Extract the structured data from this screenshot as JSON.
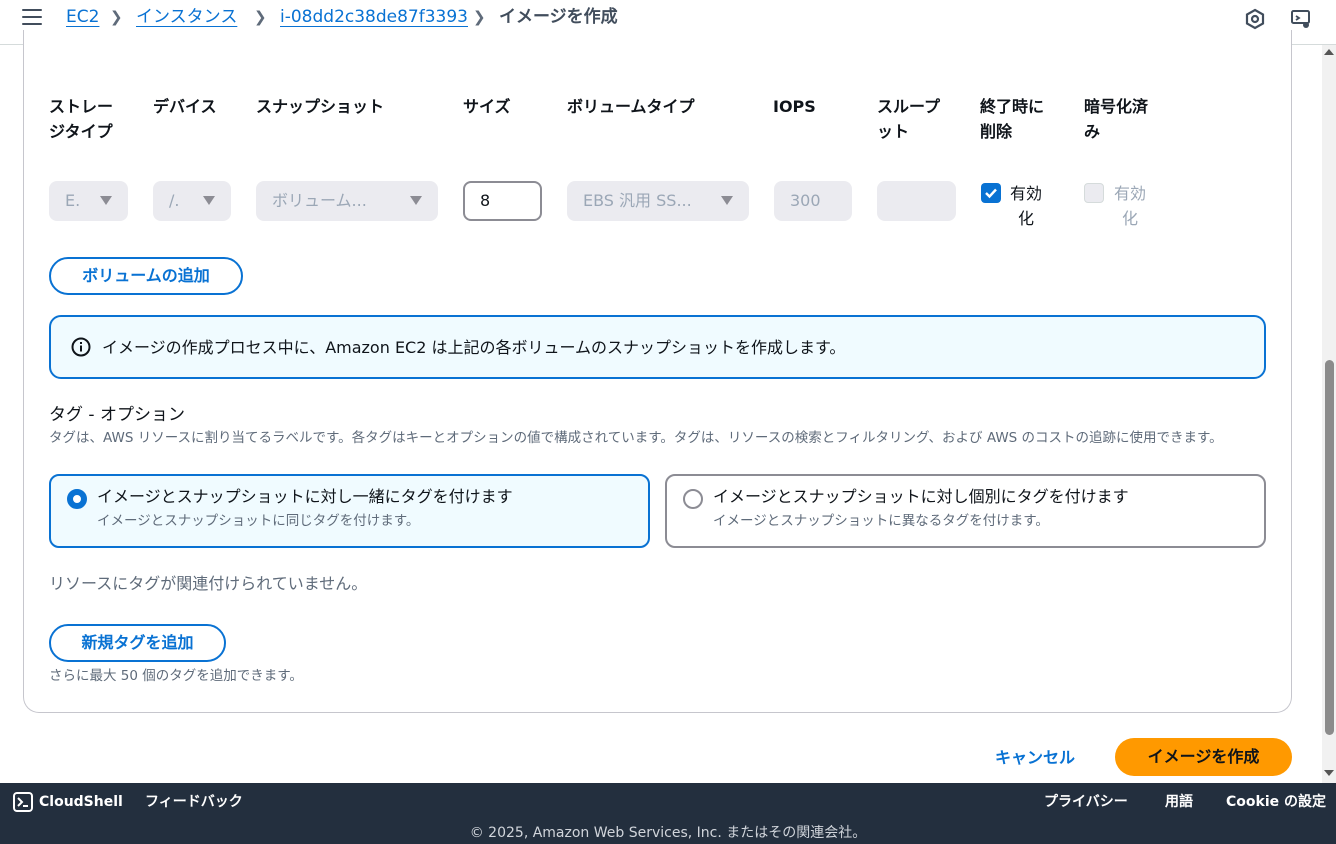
{
  "breadcrumb": {
    "items": [
      "EC2",
      "インスタンス",
      "i-08dd2c38de87f3393"
    ],
    "current": "イメージを作成"
  },
  "volume_table": {
    "headers": {
      "storage_type": "ストレージタイプ",
      "storage_type_line1": "ストレー",
      "storage_type_line2": "ジタイプ",
      "device": "デバイス",
      "snapshot": "スナップショット",
      "size": "サイズ",
      "volume_type": "ボリュームタイプ",
      "iops": "IOPS",
      "throughput_line1": "スループ",
      "throughput_line2": "ット",
      "delete_line1": "終了時に",
      "delete_line2": "削除",
      "encrypted_line1": "暗号化済",
      "encrypted_line2": "み"
    },
    "row": {
      "storage_type": "E.",
      "device": "/.",
      "snapshot": "ボリューム...",
      "size": "8",
      "volume_type": "EBS 汎用 SS...",
      "iops": "300",
      "throughput": "",
      "delete_on_termination_line1": "有効",
      "delete_on_termination_line2": "化",
      "encrypted_line1": "有効",
      "encrypted_line2": "化"
    }
  },
  "add_volume_label": "ボリュームの追加",
  "info_text": "イメージの作成プロセス中に、Amazon EC2 は上記の各ボリュームのスナップショットを作成します。",
  "tags": {
    "title": "タグ - オプション",
    "description": "タグは、AWS リソースに割り当てるラベルです。各タグはキーとオプションの値で構成されています。タグは、リソースの検索とフィルタリング、および AWS のコストの追跡に使用できます。",
    "options": [
      {
        "title": "イメージとスナップショットに対し一緒にタグを付けます",
        "desc": "イメージとスナップショットに同じタグを付けます。"
      },
      {
        "title": "イメージとスナップショットに対し個別にタグを付けます",
        "desc": "イメージとスナップショットに異なるタグを付けます。"
      }
    ],
    "empty_text": "リソースにタグが関連付けられていません。",
    "add_tag_label": "新規タグを追加",
    "hint": "さらに最大 50 個のタグを追加できます。"
  },
  "actions": {
    "cancel": "キャンセル",
    "create": "イメージを作成"
  },
  "footer": {
    "cloudshell": "CloudShell",
    "feedback": "フィードバック",
    "privacy": "プライバシー",
    "language": "用語",
    "cookie": "Cookie の設定",
    "copyright": "© 2025, Amazon Web Services, Inc. またはその関連会社。"
  },
  "colors": {
    "accent": "#0972d3",
    "primary_button": "#ff9900",
    "footer_bg": "#232f3e"
  }
}
